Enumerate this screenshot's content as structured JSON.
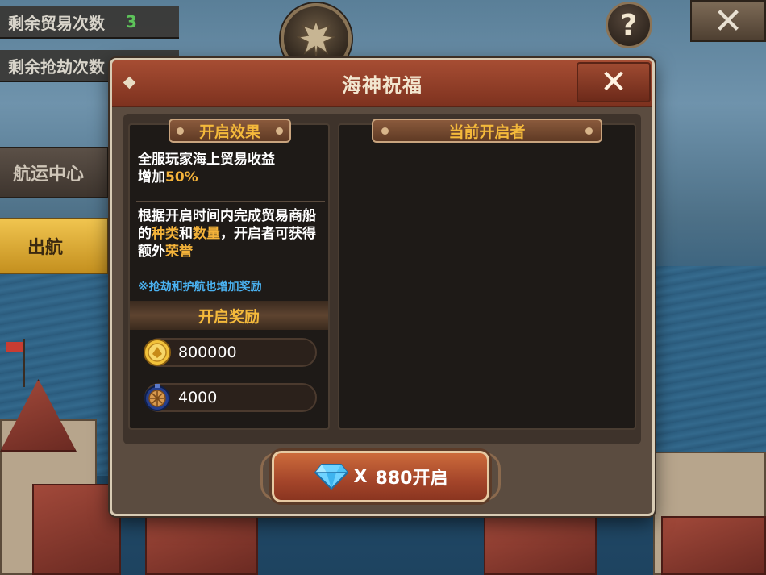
{
  "hud": {
    "trade_remaining_label": "剩余贸易次数",
    "trade_remaining_count": "3",
    "plunder_remaining_label": "剩余抢劫次数",
    "help_label": "?",
    "close_label": "✕"
  },
  "side": {
    "shipping_center_label": "航运中心",
    "sail_label": "出航"
  },
  "modal": {
    "title": "海神祝福",
    "close_label": "✕",
    "effect": {
      "header": "开启效果",
      "line1": "全服玩家海上贸易收益",
      "line2_prefix": "增加",
      "line2_value": "50%",
      "rule_part1": "根据开启时间内完成贸易商船的",
      "rule_kind": "种类",
      "rule_and": "和",
      "rule_qty": "数量",
      "rule_part2": "，开启者可获得额外",
      "rule_honor": "荣誉",
      "note": "※抢劫和护航也增加奖励"
    },
    "rewards": {
      "header": "开启奖励",
      "items": [
        {
          "icon": "gold-coin-icon",
          "value": "800000"
        },
        {
          "icon": "compass-medal-icon",
          "value": "4000"
        }
      ]
    },
    "openers": {
      "header": "当前开启者"
    },
    "open_button": {
      "multiplier": "X",
      "cost": "880开启",
      "icon": "diamond-icon"
    }
  },
  "colors": {
    "accent_gold": "#f4b93b",
    "highlight": "#f4b33a",
    "note_blue": "#4ab1f0",
    "header_red": "#a64d33"
  }
}
